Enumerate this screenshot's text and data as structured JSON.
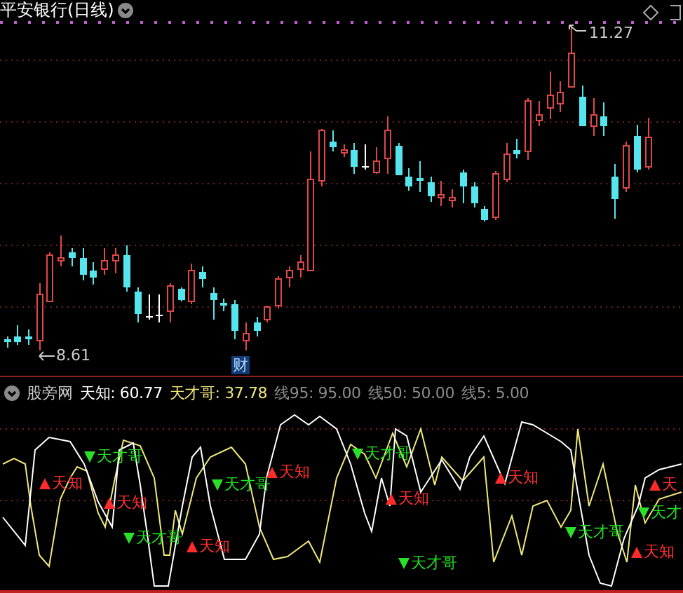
{
  "price_chart": {
    "title": "平安银行(日线)",
    "high_label": "11.27",
    "low_label": "8.61",
    "event_marker": "财"
  },
  "indicator": {
    "name": "股旁网",
    "values": [
      {
        "label": "天知:",
        "value": "60.77",
        "color": "#ffffff"
      },
      {
        "label": "天才哥:",
        "value": "37.78",
        "color": "#f0e878"
      },
      {
        "label": "线95:",
        "value": "95.00",
        "color": "#8c8c8c"
      },
      {
        "label": "线50:",
        "value": "50.00",
        "color": "#8c8c8c"
      },
      {
        "label": "线5:",
        "value": "5.00",
        "color": "#8c8c8c"
      }
    ],
    "signals": [
      {
        "kind": "buy",
        "label": "天知"
      },
      {
        "kind": "sell",
        "label": "天才哥"
      },
      {
        "kind": "buy",
        "label": "天知"
      },
      {
        "kind": "sell",
        "label": "天才哥"
      },
      {
        "kind": "buy",
        "label": "天知"
      },
      {
        "kind": "sell",
        "label": "天才哥"
      },
      {
        "kind": "buy",
        "label": "天知"
      },
      {
        "kind": "sell",
        "label": "天才哥"
      },
      {
        "kind": "buy",
        "label": "天知"
      },
      {
        "kind": "sell",
        "label": "天才哥"
      },
      {
        "kind": "buy",
        "label": "天知"
      },
      {
        "kind": "sell",
        "label": "天才哥"
      },
      {
        "kind": "buy",
        "label": "天"
      },
      {
        "kind": "sell",
        "label": "天才"
      },
      {
        "kind": "buy",
        "label": "天知"
      }
    ]
  }
}
